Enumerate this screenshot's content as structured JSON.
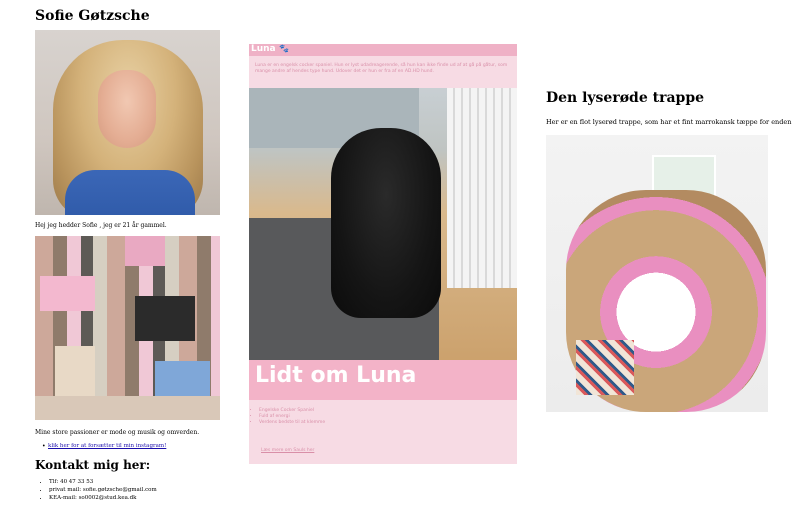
{
  "left": {
    "name": "Sofie Gøtzsche",
    "intro": "Hej jeg hedder Sofie , jeg er 21 år gammel.",
    "interests": "Mine store passioner er mode og musik og omverden.",
    "instagram_link": "klik her for at forsætter til min instagram!",
    "contact_heading": "Kontakt mig her:",
    "contacts": [
      "Tlf: 40 47 33 53",
      "privat mail: sofie.gøtzsche@gmail.com",
      "KEA-mail: so0002@stud.kea.dk"
    ]
  },
  "card": {
    "title": "Luna",
    "description": "Luna er en engelsk cocker spaniel. Hun er lyst udadreagerende, så hun kan ikke finde ud af at gå på gåtur, som mange andre af hendes type hund. Udover det er hun er fra af en AD.HD hund.",
    "heading": "Lidt om Luna",
    "facts": [
      "Engelske Cocker Spaniel",
      "Fuld af energi",
      "Verdens bedste til at klemme"
    ],
    "link": "Læs mere om Sauls her"
  },
  "right": {
    "heading": "Den lyserøde trappe",
    "text": "Her er en flot lyserød trappe, som har et fint marrokansk tæppe for enden"
  },
  "colors": {
    "card_bg": "#f7dbe4",
    "card_accent": "#f3b3c8",
    "link": "#1a0dab"
  }
}
